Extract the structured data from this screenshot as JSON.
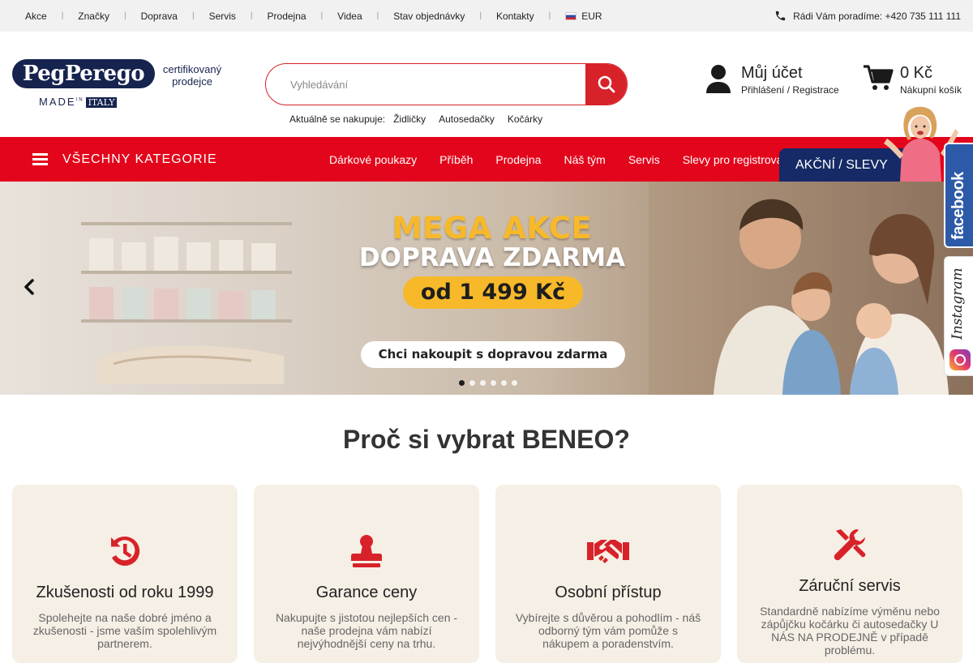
{
  "topbar": {
    "links": [
      "Akce",
      "Značky",
      "Doprava",
      "Servis",
      "Prodejna",
      "Videa",
      "Stav objednávky",
      "Kontakty"
    ],
    "currency": "EUR",
    "phone_text": "Rádi Vám poradíme: +420 735 111 111"
  },
  "logo": {
    "brand": "PegPerego",
    "made_in": "MADE",
    "in": "IN",
    "italy": "ITALY",
    "certified_line1": "certifikovaný",
    "certified_line2": "prodejce"
  },
  "search": {
    "placeholder": "Vyhledávání",
    "shopping_label": "Aktuálně se nakupuje:",
    "shopping_links": [
      "Židličky",
      "Autosedačky",
      "Kočárky"
    ]
  },
  "account": {
    "title": "Můj účet",
    "subtitle": "Přihlášení / Registrace"
  },
  "cart": {
    "amount": "0 Kč",
    "label": "Nákupní košík"
  },
  "nav": {
    "all_categories": "VŠECHNY KATEGORIE",
    "items": [
      "Dárkové poukazy",
      "Příběh",
      "Prodejna",
      "Náš tým",
      "Servis",
      "Slevy pro registrova"
    ],
    "promo": "AKČNÍ / SLEVY"
  },
  "hero": {
    "title1": "MEGA AKCE",
    "title2": "DOPRAVA ZDARMA",
    "price": "od 1 499 Kč",
    "cta": "Chci nakoupit s dopravou zdarma",
    "slide_count": 6,
    "active_slide": 0
  },
  "social": {
    "facebook": "facebook",
    "instagram": "Instagram"
  },
  "why": {
    "title": "Proč si vybrat BENEO?",
    "cards": [
      {
        "icon": "history-icon",
        "title": "Zkušenosti od roku 1999",
        "text": "Spolehejte na naše dobré jméno a zkušenosti - jsme vaším spolehlivým partnerem."
      },
      {
        "icon": "stamp-icon",
        "title": "Garance ceny",
        "text": "Nakupujte s jistotou nejlepších cen - naše prodejna vám nabízí nejvýhodnější ceny na trhu."
      },
      {
        "icon": "handshake-icon",
        "title": "Osobní přístup",
        "text": "Vybírejte s důvěrou a pohodlím - náš odborný tým vám pomůže s nákupem a poradenstvím."
      },
      {
        "icon": "tools-icon",
        "title": "Záruční servis",
        "text": "Standardně nabízíme výměnu nebo zápůjčku kočárku či autosedačky U NÁS NA PRODEJNĚ v případě problému."
      }
    ]
  },
  "colors": {
    "red": "#e3051b",
    "navy": "#152a66",
    "gold": "#f7b92a",
    "card_bg": "#f6efe5"
  }
}
